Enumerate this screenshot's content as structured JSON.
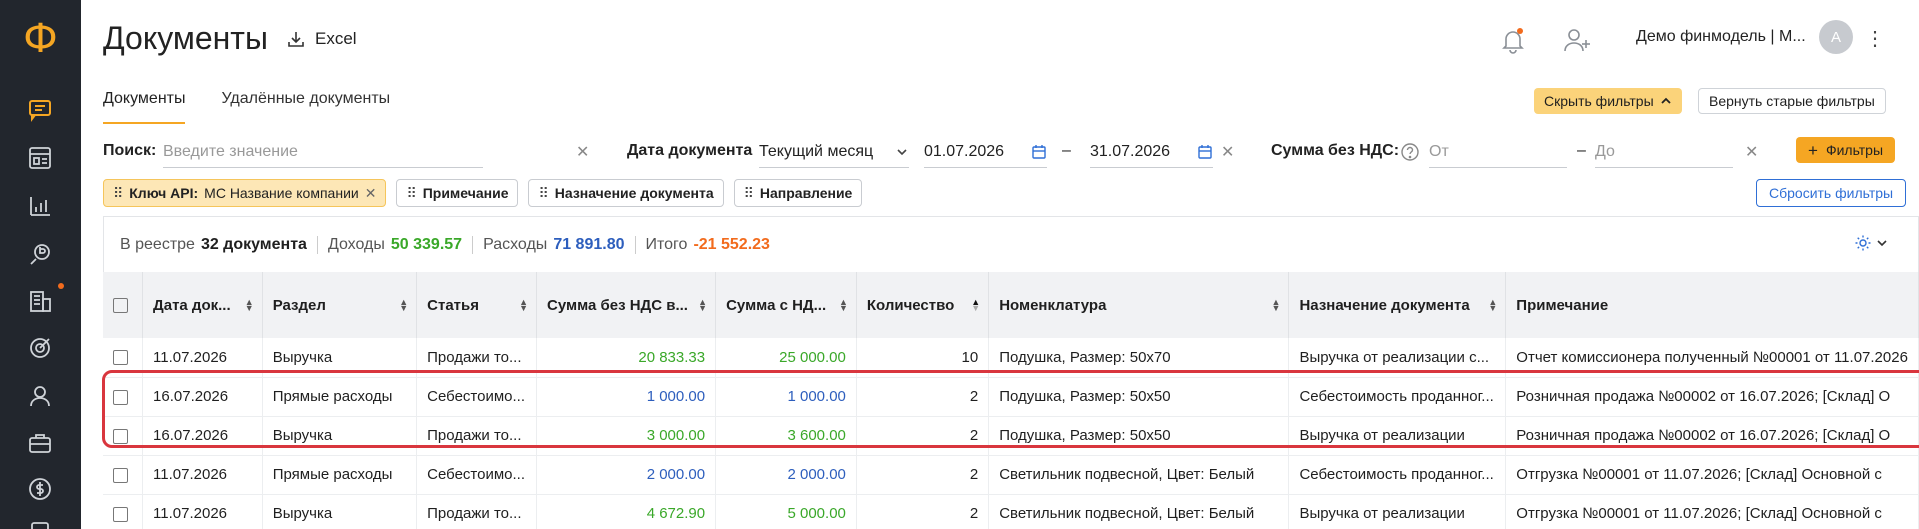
{
  "sidebar": {
    "logo": "Ф",
    "items": [
      {
        "icon": "chat-icon",
        "active": true
      },
      {
        "icon": "dashboard-icon"
      },
      {
        "icon": "chart-icon"
      },
      {
        "icon": "money-flow-icon"
      },
      {
        "icon": "building-icon",
        "badge": true
      },
      {
        "icon": "target-icon"
      },
      {
        "icon": "users-icon"
      },
      {
        "icon": "briefcase-icon"
      },
      {
        "icon": "dollar-icon"
      },
      {
        "icon": "document-icon"
      }
    ]
  },
  "header": {
    "title": "Документы",
    "excel_label": "Excel",
    "company": "Демо финмодель | М...",
    "avatar_letter": "А"
  },
  "tabs": [
    {
      "label": "Документы",
      "active": true
    },
    {
      "label": "Удалённые документы",
      "active": false
    }
  ],
  "actions": {
    "hide_filters": "Скрыть фильтры",
    "return_old_filters": "Вернуть старые фильтры",
    "filters_button": "Фильтры",
    "reset_filters": "Сбросить фильтры"
  },
  "filters": {
    "search_label": "Поиск:",
    "search_placeholder": "Введите значение",
    "date_label": "Дата документа",
    "date_period": "Текущий месяц",
    "date_from": "01.07.2026",
    "date_to": "31.07.2026",
    "dash": "–",
    "sum_label": "Сумма без НДС:",
    "sum_from_placeholder": "От",
    "sum_to_placeholder": "До"
  },
  "chips": [
    {
      "bold": "Ключ API:",
      "text": "МС Название компании",
      "closable": true
    },
    {
      "bold": "Примечание",
      "text": ""
    },
    {
      "bold": "Назначение документа",
      "text": ""
    },
    {
      "bold": "Направление",
      "text": ""
    }
  ],
  "summary": {
    "registry_label": "В реестре",
    "registry_count": "32 документа",
    "income_label": "Доходы",
    "income_value": "50 339.57",
    "expense_label": "Расходы",
    "expense_value": "71 891.80",
    "total_label": "Итого",
    "total_value": "-21 552.23"
  },
  "table": {
    "columns": [
      "Дата док...",
      "Раздел",
      "Статья",
      "Сумма без НДС в...",
      "Сумма с НД...",
      "Количество",
      "Номенклатура",
      "Назначение документа",
      "Примечание"
    ],
    "rows": [
      {
        "date": "11.07.2026",
        "section": "Выручка",
        "article": "Продажи то...",
        "sum_no_vat": "20 833.33",
        "sum_vat": "25 000.00",
        "qty": "10",
        "item": "Подушка, Размер: 50х70",
        "purpose": "Выручка от реализации с...",
        "note": "Отчет комиссионера полученный №00001 от 11.07.2026",
        "color": "green"
      },
      {
        "date": "16.07.2026",
        "section": "Прямые расходы",
        "article": "Себестоимо...",
        "sum_no_vat": "1 000.00",
        "sum_vat": "1 000.00",
        "qty": "2",
        "item": "Подушка, Размер: 50х50",
        "purpose": "Себестоимость проданног...",
        "note": "Розничная продажа №00002 от 16.07.2026; [Склад] О",
        "color": "blue"
      },
      {
        "date": "16.07.2026",
        "section": "Выручка",
        "article": "Продажи то...",
        "sum_no_vat": "3 000.00",
        "sum_vat": "3 600.00",
        "qty": "2",
        "item": "Подушка, Размер: 50х50",
        "purpose": "Выручка от реализации",
        "note": "Розничная продажа №00002 от 16.07.2026; [Склад] О",
        "color": "green"
      },
      {
        "date": "11.07.2026",
        "section": "Прямые расходы",
        "article": "Себестоимо...",
        "sum_no_vat": "2 000.00",
        "sum_vat": "2 000.00",
        "qty": "2",
        "item": "Светильник подвесной, Цвет: Белый",
        "purpose": "Себестоимость проданног...",
        "note": "Отгрузка №00001 от 11.07.2026; [Склад] Основной с",
        "color": "blue"
      },
      {
        "date": "11.07.2026",
        "section": "Выручка",
        "article": "Продажи то...",
        "sum_no_vat": "4 672.90",
        "sum_vat": "5 000.00",
        "qty": "2",
        "item": "Светильник подвесной, Цвет: Белый",
        "purpose": "Выручка от реализации",
        "note": "Отгрузка №00001 от 11.07.2026; [Склад] Основной с",
        "color": "green"
      }
    ]
  },
  "colors": {
    "sidebar_bg": "#22262d",
    "accent": "#f5a623",
    "income_green": "#3aa829",
    "expense_blue": "#2d5ebd",
    "total_orange": "#f26b1d",
    "highlight_red": "#d9363e"
  }
}
